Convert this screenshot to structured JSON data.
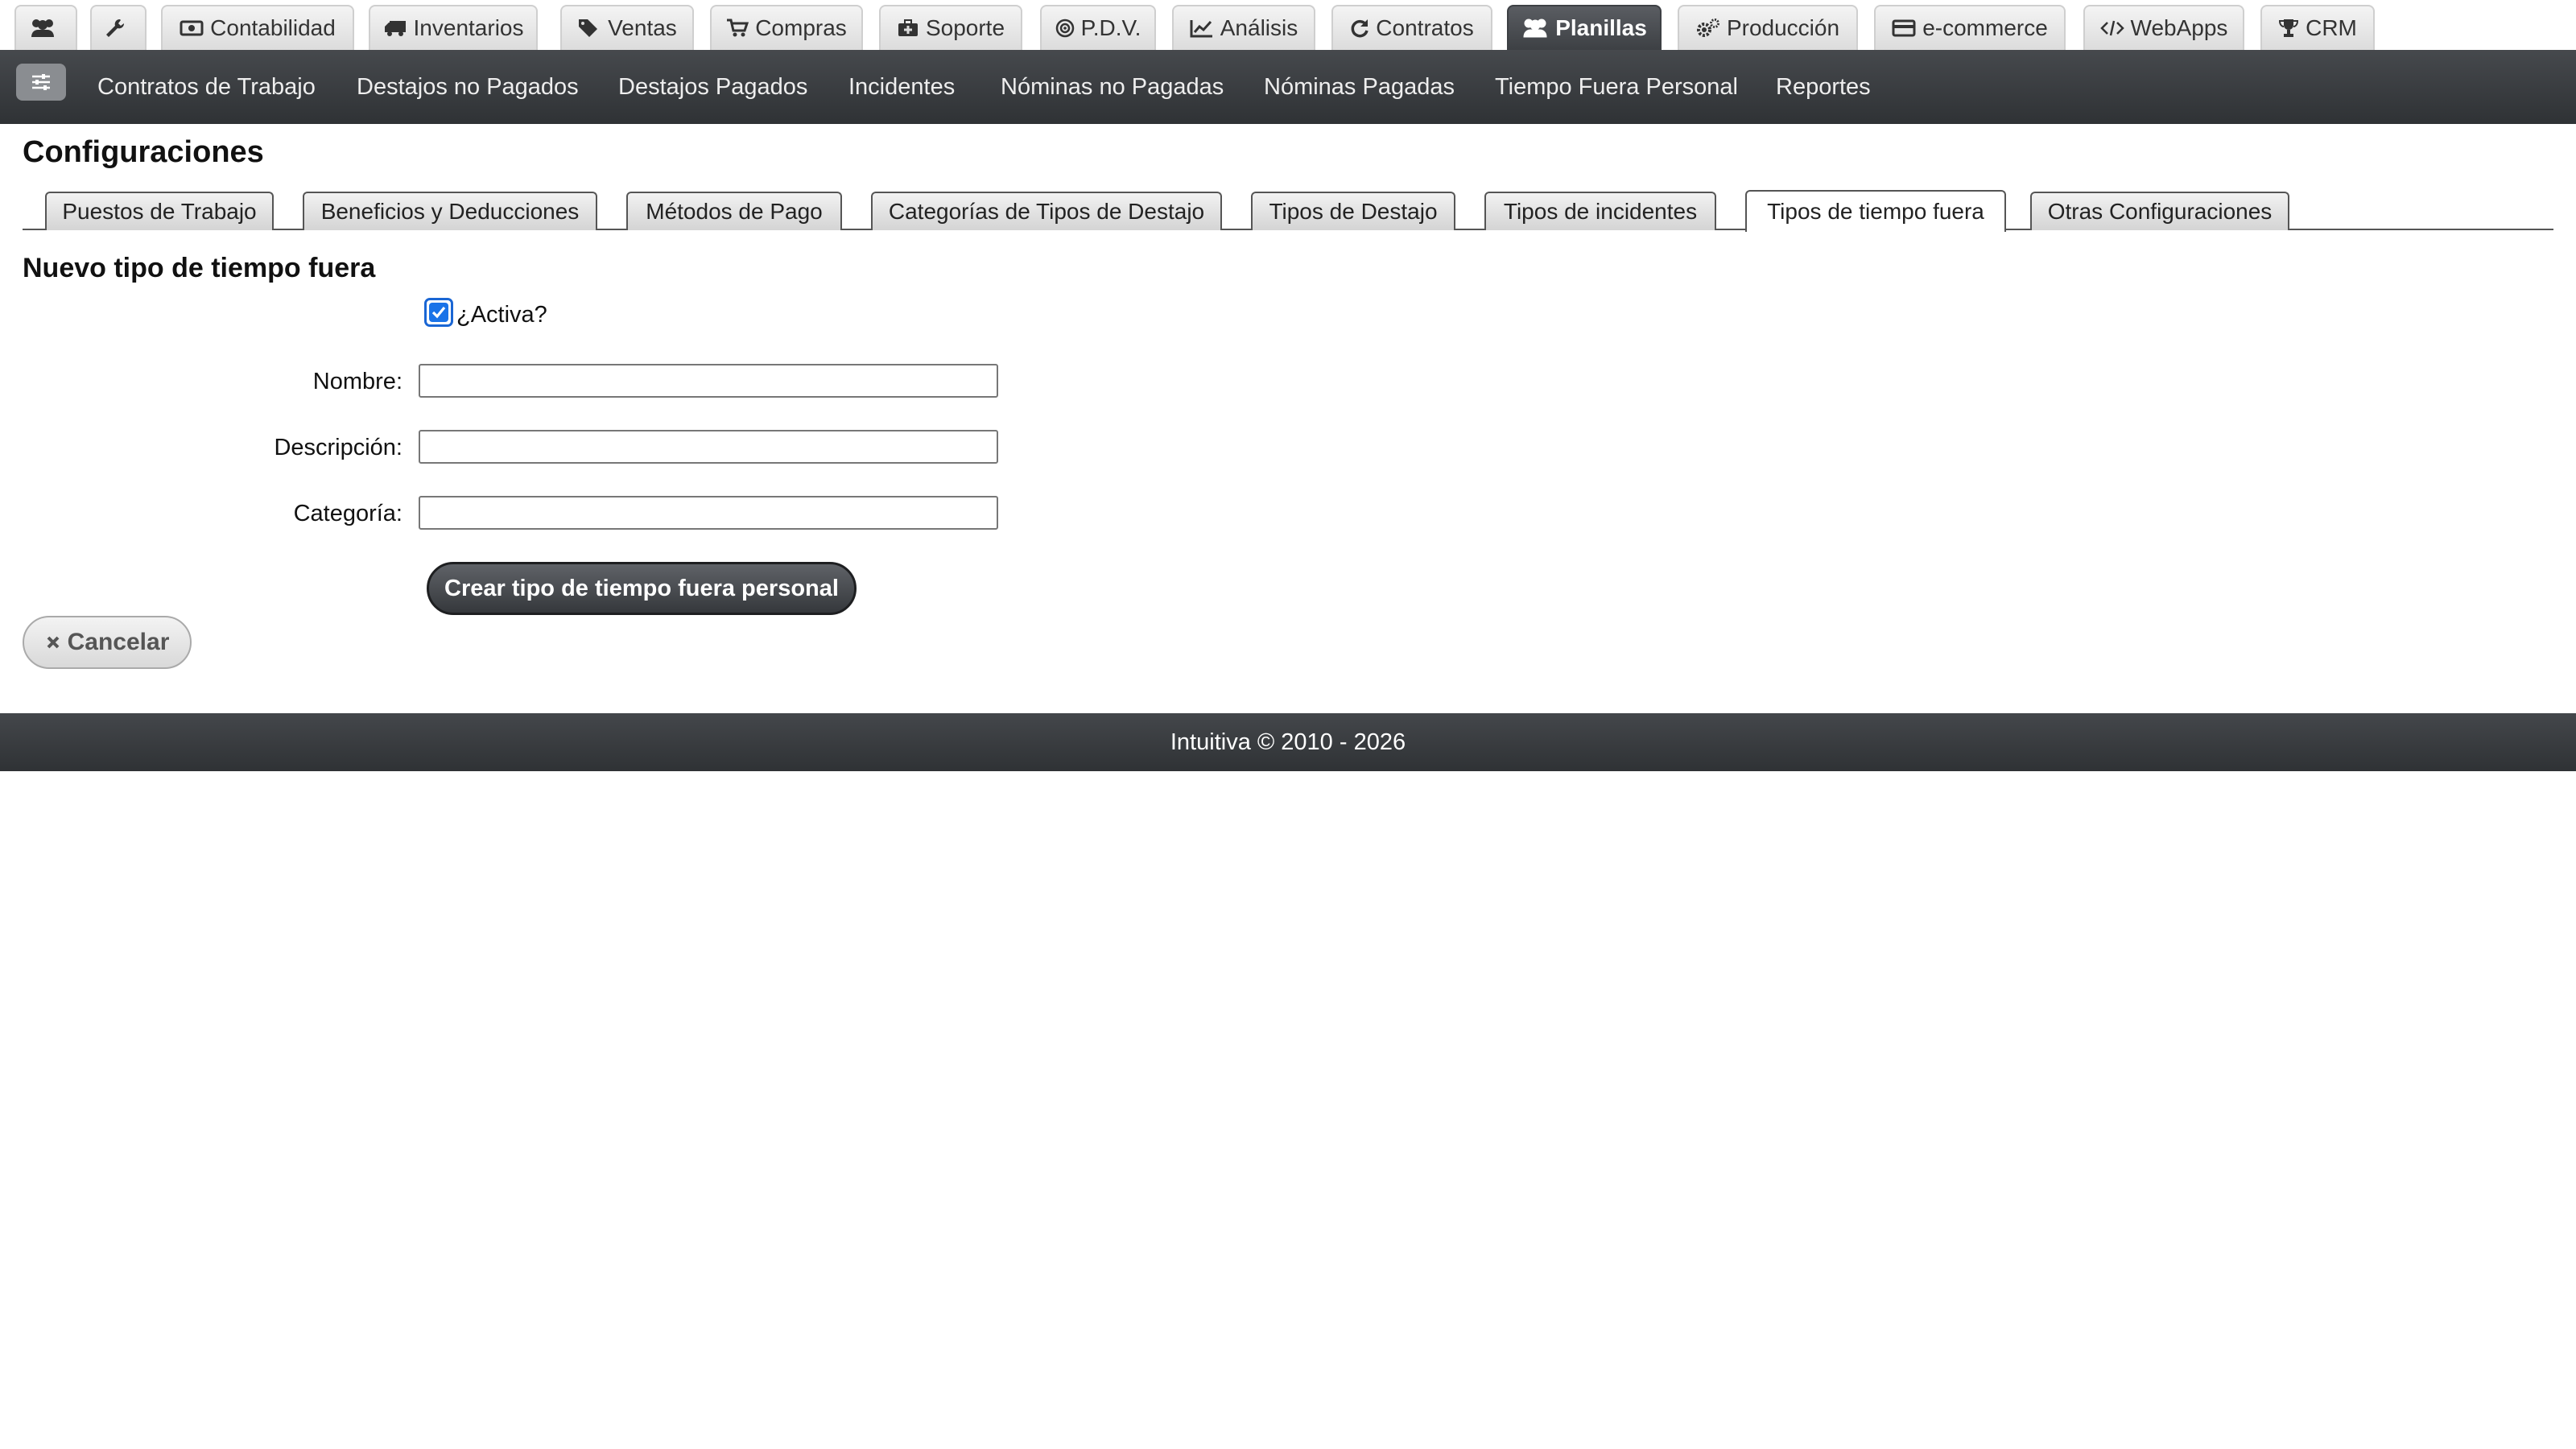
{
  "top_modules": [
    {
      "label": "",
      "icon": "users-icon"
    },
    {
      "label": "",
      "icon": "wrench-icon"
    },
    {
      "label": "Contabilidad",
      "icon": "money-icon"
    },
    {
      "label": "Inventarios",
      "icon": "truck-icon"
    },
    {
      "label": "Ventas",
      "icon": "tags-icon"
    },
    {
      "label": "Compras",
      "icon": "cart-icon"
    },
    {
      "label": "Soporte",
      "icon": "medkit-icon"
    },
    {
      "label": "P.D.V.",
      "icon": "bullseye-icon"
    },
    {
      "label": "Análisis",
      "icon": "line-chart-icon"
    },
    {
      "label": "Contratos",
      "icon": "refresh-icon"
    },
    {
      "label": "Planillas",
      "icon": "users-icon",
      "active": true
    },
    {
      "label": "Producción",
      "icon": "cogs-icon"
    },
    {
      "label": "e-commerce",
      "icon": "credit-card-icon"
    },
    {
      "label": "WebApps",
      "icon": "code-icon"
    },
    {
      "label": "CRM",
      "icon": "trophy-icon"
    }
  ],
  "subnav": {
    "toggle_icon": "sliders-icon",
    "items": [
      "Contratos de Trabajo",
      "Destajos no Pagados",
      "Destajos Pagados",
      "Incidentes",
      "Nóminas no Pagadas",
      "Nóminas Pagadas",
      "Tiempo Fuera Personal",
      "Reportes"
    ]
  },
  "page": {
    "title": "Configuraciones",
    "config_tabs": [
      "Puestos de Trabajo",
      "Beneficios y Deducciones",
      "Métodos de Pago",
      "Categorías de Tipos de Destajo",
      "Tipos de Destajo",
      "Tipos de incidentes",
      "Tipos de tiempo fuera",
      "Otras Configuraciones"
    ],
    "active_tab": "Tipos de tiempo fuera"
  },
  "form": {
    "title": "Nuevo tipo de tiempo fuera",
    "active_label": "¿Activa?",
    "active_checked": true,
    "name_label": "Nombre:",
    "name_value": "",
    "description_label": "Descripción:",
    "description_value": "",
    "category_label": "Categoría:",
    "category_value": "",
    "submit_label": "Crear tipo de tiempo fuera personal",
    "cancel_label": "Cancelar",
    "cancel_icon": "close-icon"
  },
  "footer": {
    "text": "Intuitiva © 2010 - 2026"
  },
  "colors": {
    "nav_dark": "#3a3d41",
    "checkbox_blue": "#1a73e8",
    "tab_active_bg": "#ffffff"
  }
}
